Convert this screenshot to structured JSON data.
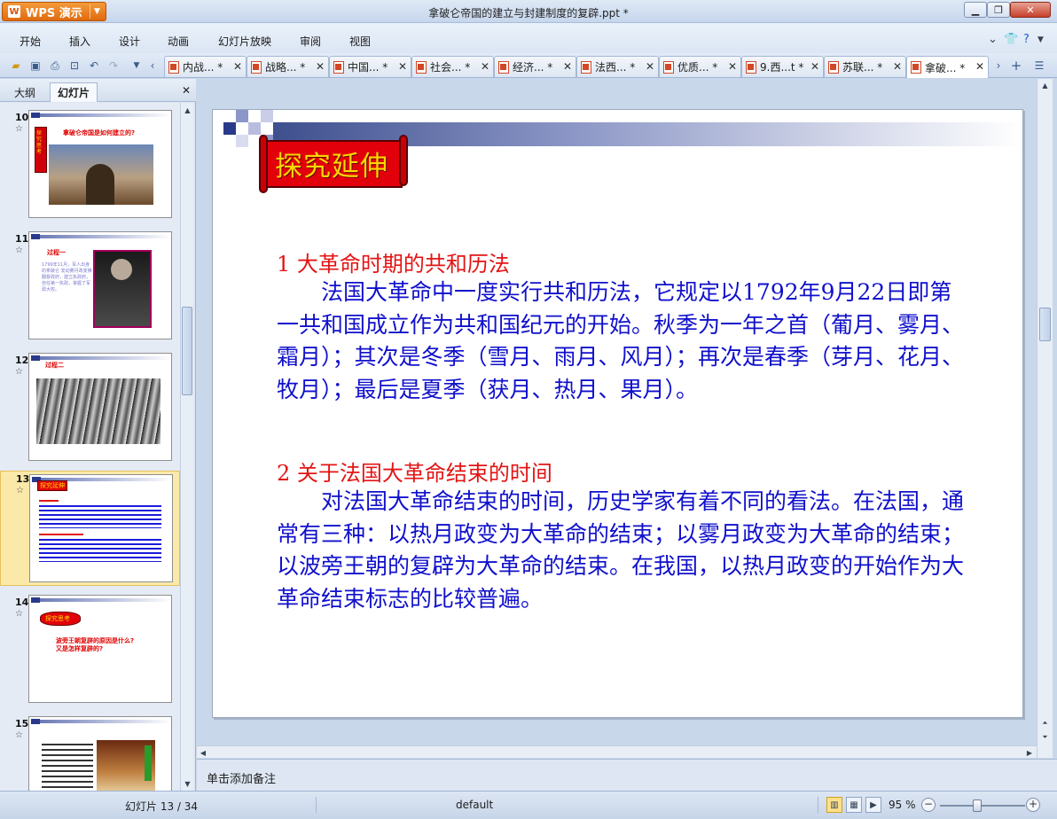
{
  "app": {
    "brand": "WPS 演示",
    "window_title": "拿破仑帝国的建立与封建制度的复辟.ppt *"
  },
  "menu": [
    "开始",
    "插入",
    "设计",
    "动画",
    "幻灯片放映",
    "审阅",
    "视图"
  ],
  "doc_tabs": [
    {
      "label": "内战... *"
    },
    {
      "label": "战略... *"
    },
    {
      "label": "中国... *"
    },
    {
      "label": "社会... *"
    },
    {
      "label": "经济... *"
    },
    {
      "label": "法西... *"
    },
    {
      "label": "优质... *"
    },
    {
      "label": "9.西...t *"
    },
    {
      "label": "苏联... *"
    },
    {
      "label": "拿破... *",
      "active": true
    }
  ],
  "left_panel": {
    "tabs": [
      "大纲",
      "幻灯片"
    ],
    "active_tab": "幻灯片",
    "thumbnails": [
      {
        "num": "10",
        "title": "拿破仑帝国是如何建立的?",
        "side_label": "探究思考"
      },
      {
        "num": "11",
        "title": "过程一",
        "body": "1799年11月，军人出身的拿破仑 发动雾月政变推翻督政府，建立执政府，自任第一执政，掌握了军政大权。"
      },
      {
        "num": "12",
        "title": "过程二"
      },
      {
        "num": "13",
        "title": "探究延伸",
        "selected": true
      },
      {
        "num": "14",
        "title": "探究思考",
        "body1": "波旁王朝复辟的原因是什么?",
        "body2": "又是怎样复辟的?"
      },
      {
        "num": "15"
      }
    ]
  },
  "slide": {
    "banner": "探究延伸",
    "section1_heading": "1 大革命时期的共和历法",
    "section1_body": "法国大革命中一度实行共和历法，它规定以1792年9月22日即第一共和国成立作为共和国纪元的开始。秋季为一年之首（葡月、雾月、霜月）；其次是冬季（雪月、雨月、风月）；再次是春季（芽月、花月、牧月）；最后是夏季（获月、热月、果月）。",
    "section2_heading": "2 关于法国大革命结束的时间",
    "section2_body": "对法国大革命结束的时间，历史学家有着不同的看法。在法国，通常有三种：以热月政变为大革命的结束；以雾月政变为大革命的结束；以波旁王朝的复辟为大革命的结束。在我国，以热月政变的开始作为大革命结束标志的比较普遍。"
  },
  "notes_placeholder": "单击添加备注",
  "status": {
    "slide_indicator": "幻灯片 13 / 34",
    "theme": "default",
    "zoom": "95 %"
  }
}
